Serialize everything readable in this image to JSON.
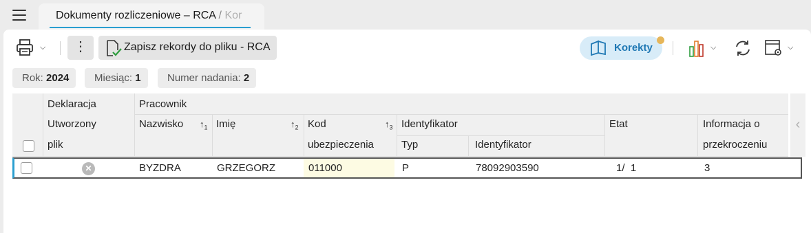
{
  "tab": {
    "title": "Dokumenty rozliczeniowe – RCA",
    "separator": "/",
    "subtitle": "Kor"
  },
  "toolbar": {
    "save_label": "Zapisz rekordy do pliku - RCA",
    "more_label": "⋮",
    "korekty_label": "Korekty"
  },
  "filters": [
    {
      "label": "Rok:",
      "value": "2024"
    },
    {
      "label": "Miesiąc:",
      "value": "1"
    },
    {
      "label": "Numer nadania:",
      "value": "2"
    }
  ],
  "grid": {
    "headers": {
      "deklaracja": "Deklaracja",
      "utworzony": "Utworzony",
      "plik": "plik",
      "pracownik": "Pracownik",
      "nazwisko": "Nazwisko",
      "imie": "Imię",
      "kod": "Kod",
      "ubezpieczenia": "ubezpieczenia",
      "identyfikator_group": "Identyfikator",
      "typ": "Typ",
      "identyfikator": "Identyfikator",
      "etat": "Etat",
      "informacja_o": "Informacja o",
      "przekroczeniu": "przekroczeniu"
    },
    "sort": {
      "nazwisko": {
        "arrow": "↑",
        "order": "1"
      },
      "imie": {
        "arrow": "↑",
        "order": "2"
      },
      "kod": {
        "arrow": "↑",
        "order": "3"
      }
    },
    "rows": [
      {
        "nazwisko": "BYZDRA",
        "imie": "GRZEGORZ",
        "kod": "011000",
        "typ": "P",
        "identyfikator": "78092903590",
        "etat": "1/  1",
        "informacja": "3"
      }
    ]
  },
  "colors": {
    "accent": "#2a9fd0",
    "korekty_bg": "#d8ecf8",
    "korekty_text": "#1f78b4",
    "badge": "#e6b65a",
    "kod_highlight": "#fdfbe3"
  }
}
